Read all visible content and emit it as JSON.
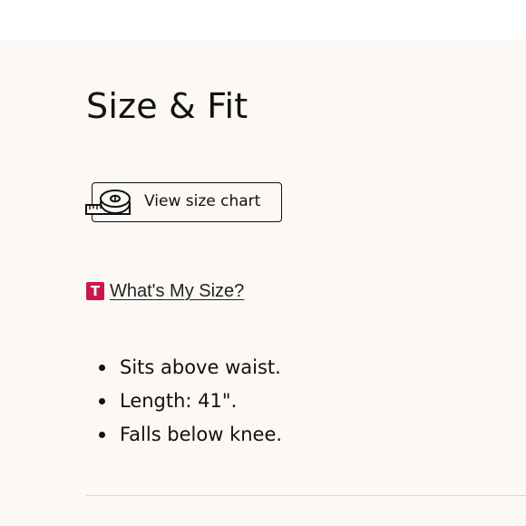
{
  "section": {
    "title": "Size & Fit"
  },
  "size_chart": {
    "label": "View size chart",
    "icon": "measuring-tape-icon"
  },
  "whats_my_size": {
    "badge": "T",
    "badge_color": "#c8184a",
    "label": "What's My Size?"
  },
  "details": [
    "Sits above waist.",
    "Length: 41\".",
    "Falls below knee."
  ]
}
